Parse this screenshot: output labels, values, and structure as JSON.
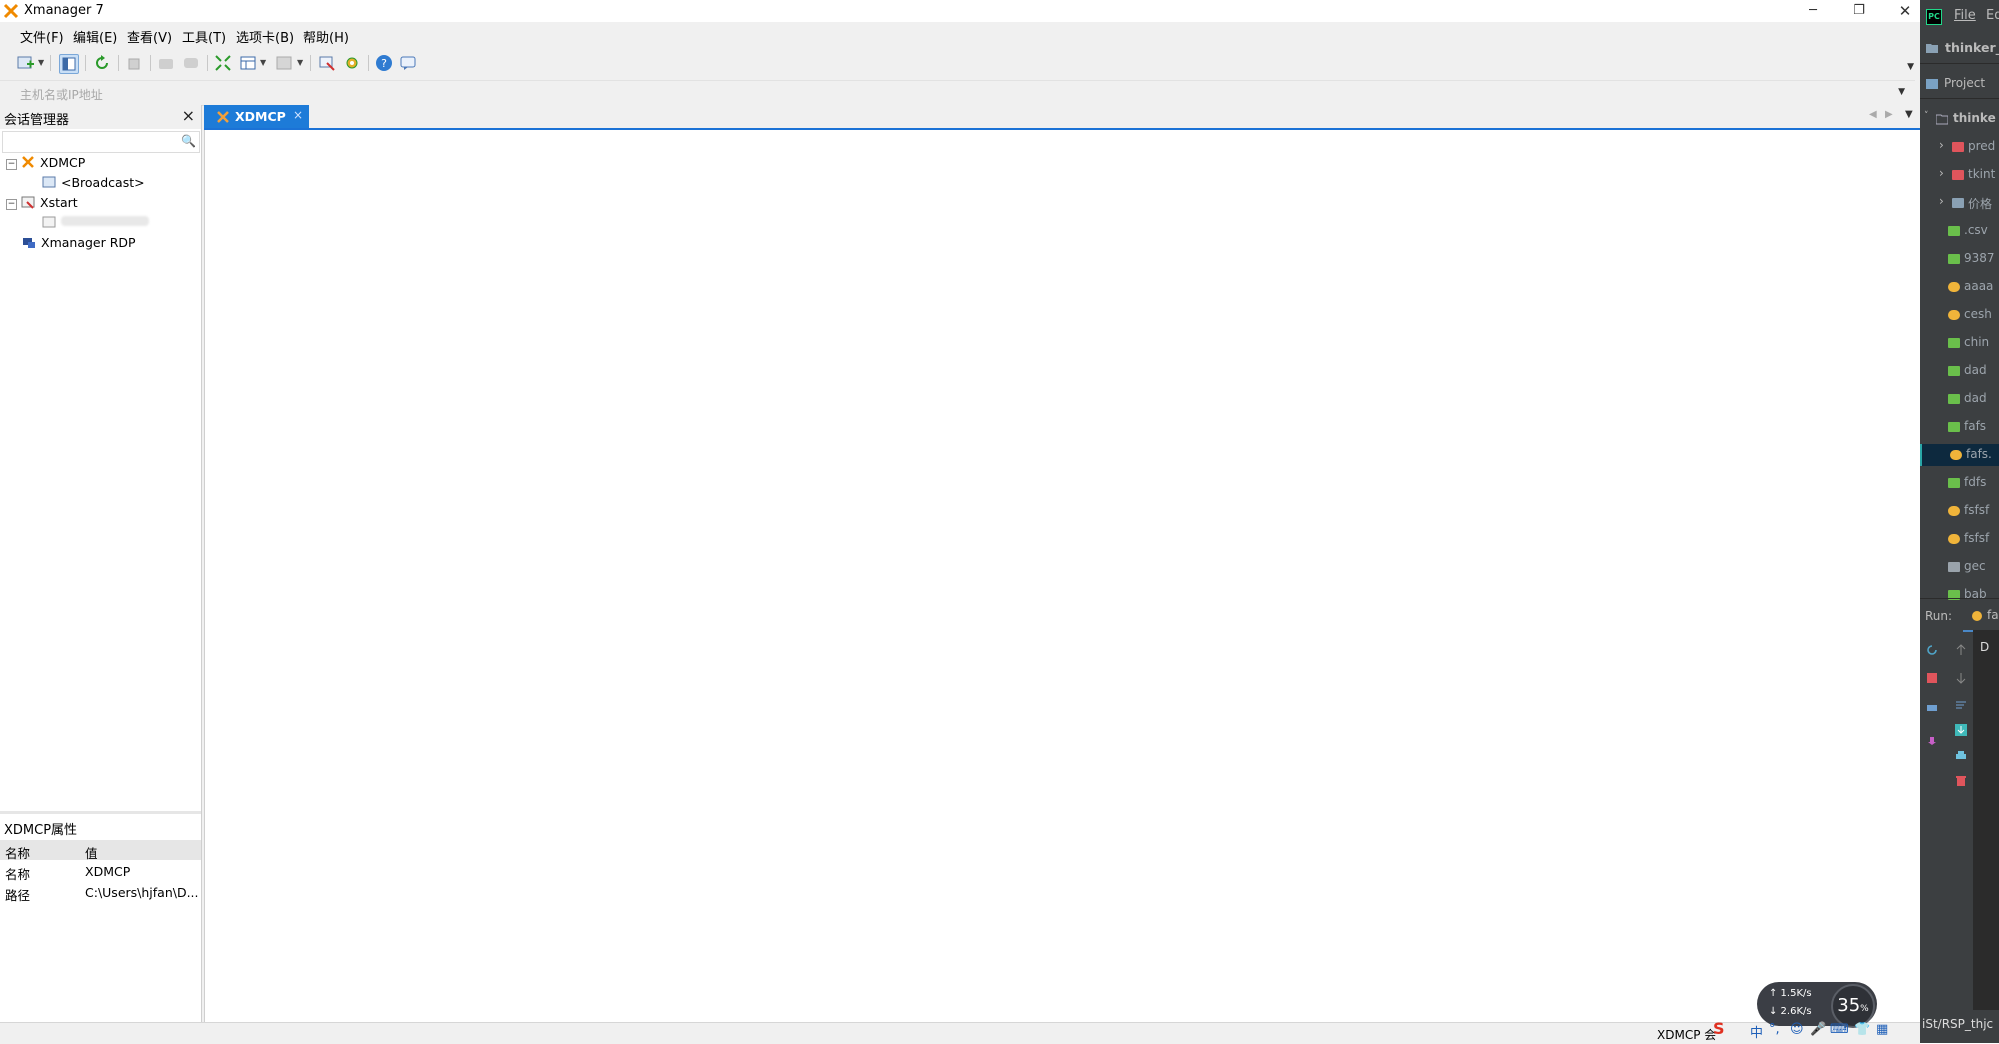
{
  "window": {
    "title": "Xmanager 7",
    "minimize": "─",
    "restore": "❐",
    "close": "✕"
  },
  "menu": [
    "文件(F)",
    "编辑(E)",
    "查看(V)",
    "工具(T)",
    "选项卡(B)",
    "帮助(H)"
  ],
  "address_bar": {
    "placeholder": "主机名或IP地址"
  },
  "session_manager": {
    "title": "会话管理器",
    "tree": [
      {
        "label": "XDMCP",
        "expanded": true
      },
      {
        "label": "<Broadcast>"
      },
      {
        "label": "Xstart",
        "expanded": true
      },
      {
        "label": ""
      },
      {
        "label": "Xmanager RDP"
      }
    ]
  },
  "properties": {
    "title": "XDMCP属性",
    "col_name": "名称",
    "col_value": "值",
    "rows": [
      {
        "name": "名称",
        "value": "XDMCP"
      },
      {
        "name": "路径",
        "value": "C:\\Users\\hjfan\\D..."
      }
    ]
  },
  "tabs": [
    {
      "label": "XDMCP",
      "close": "×"
    }
  ],
  "status_bar": {
    "text": "XDMCP 会"
  },
  "net_widget": {
    "upload": "↑ 1.5K/s",
    "download": "↓ 2.6K/s",
    "percent": "35",
    "percent_unit": "%"
  },
  "tray": [
    "S",
    "中",
    "°,",
    "☺",
    "🎤",
    "⌨",
    "👕",
    "▦"
  ],
  "ide": {
    "menu_file": "File",
    "menu_edit": "Ed",
    "project_name": "thinker_",
    "project_tab": "Project",
    "root": "thinke",
    "files": [
      {
        "name": "pred",
        "kind": "folder-red"
      },
      {
        "name": "tkint",
        "kind": "folder-red"
      },
      {
        "name": "价格",
        "kind": "folder"
      },
      {
        "name": ".csv",
        "kind": "csv"
      },
      {
        "name": "9387",
        "kind": "image"
      },
      {
        "name": "aaaa",
        "kind": "python"
      },
      {
        "name": "cesh",
        "kind": "python"
      },
      {
        "name": "chin",
        "kind": "image"
      },
      {
        "name": "dad",
        "kind": "csv"
      },
      {
        "name": "dad",
        "kind": "csv"
      },
      {
        "name": "fafs",
        "kind": "csv"
      },
      {
        "name": "fafs.",
        "kind": "python"
      },
      {
        "name": "fdfs",
        "kind": "csv"
      },
      {
        "name": "fsfsf",
        "kind": "python"
      },
      {
        "name": "fsfsf",
        "kind": "python"
      },
      {
        "name": "gec",
        "kind": "text"
      },
      {
        "name": "bab",
        "kind": "csv"
      }
    ],
    "run_label": "Run:",
    "run_tab": "fa",
    "console_char": "D",
    "status_text": "iSt/RSP_thjc"
  }
}
